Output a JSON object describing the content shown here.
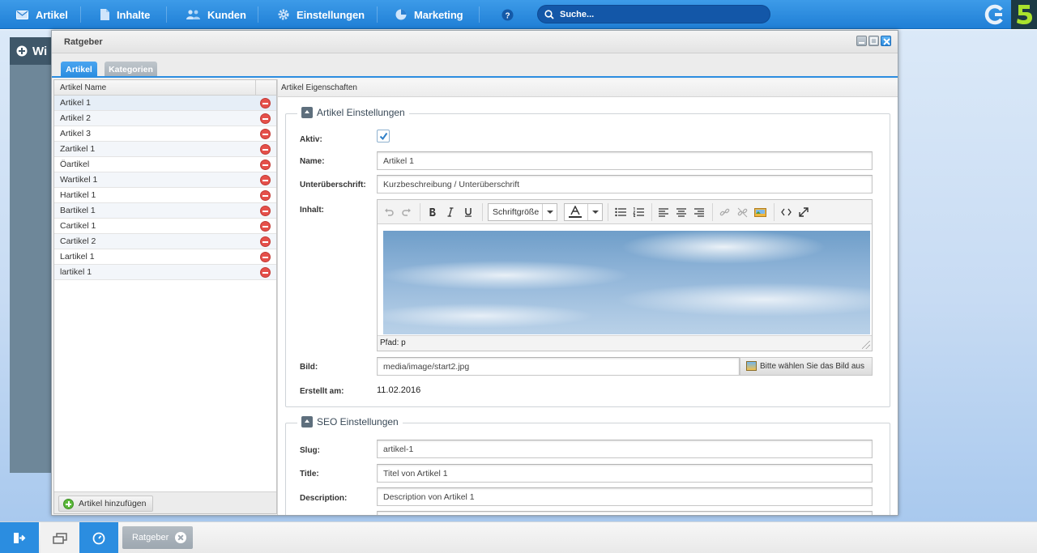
{
  "nav": {
    "items": [
      {
        "label": "Artikel",
        "icon": "envelope-icon"
      },
      {
        "label": "Inhalte",
        "icon": "document-icon"
      },
      {
        "label": "Kunden",
        "icon": "users-icon"
      },
      {
        "label": "Einstellungen",
        "icon": "gear-icon"
      },
      {
        "label": "Marketing",
        "icon": "pie-chart-icon"
      }
    ],
    "help_icon": "question-icon",
    "search_placeholder": "Suche..."
  },
  "background_window": {
    "title": "Wi"
  },
  "window": {
    "title": "Ratgeber",
    "tabs": [
      {
        "label": "Artikel",
        "active": true
      },
      {
        "label": "Kategorien",
        "active": false
      }
    ],
    "grid": {
      "column_header": "Artikel Name",
      "rows": [
        {
          "name": "Artikel 1"
        },
        {
          "name": "Artikel 2"
        },
        {
          "name": "Artikel 3"
        },
        {
          "name": "Zartikel 1"
        },
        {
          "name": "Öartikel"
        },
        {
          "name": "Wartikel 1"
        },
        {
          "name": "Hartikel 1"
        },
        {
          "name": "Bartikel 1"
        },
        {
          "name": "Cartikel 1"
        },
        {
          "name": "Cartikel 2"
        },
        {
          "name": "Lartikel 1"
        },
        {
          "name": "lartikel 1"
        }
      ],
      "add_button": "Artikel hinzufügen"
    },
    "panel": {
      "header": "Artikel Eigenschaften",
      "artikel_section": {
        "legend": "Artikel Einstellungen",
        "aktiv_label": "Aktiv:",
        "aktiv_checked": true,
        "name_label": "Name:",
        "name_value": "Artikel 1",
        "subtitle_label": "Unterüberschrift:",
        "subtitle_value": "Kurzbeschreibung / Unterüberschrift",
        "content_label": "Inhalt:",
        "font_size_select": "Schriftgröße",
        "path_label": "Pfad: p",
        "image_label": "Bild:",
        "image_value": "media/image/start2.jpg",
        "image_button": "Bitte wählen Sie das Bild aus",
        "created_label": "Erstellt am:",
        "created_value": "11.02.2016"
      },
      "seo_section": {
        "legend": "SEO Einstellungen",
        "slug_label": "Slug:",
        "slug_value": "artikel-1",
        "title_label": "Title:",
        "title_value": "Titel von Artikel 1",
        "description_label": "Description:",
        "description_value": "Description von Artikel 1"
      }
    }
  },
  "taskbar": {
    "open_window": "Ratgeber"
  },
  "colors": {
    "accent": "#2b8de0",
    "nav_bar": "#1f7fd6",
    "delete_red": "#e5504a",
    "add_green": "#5bb83a"
  }
}
